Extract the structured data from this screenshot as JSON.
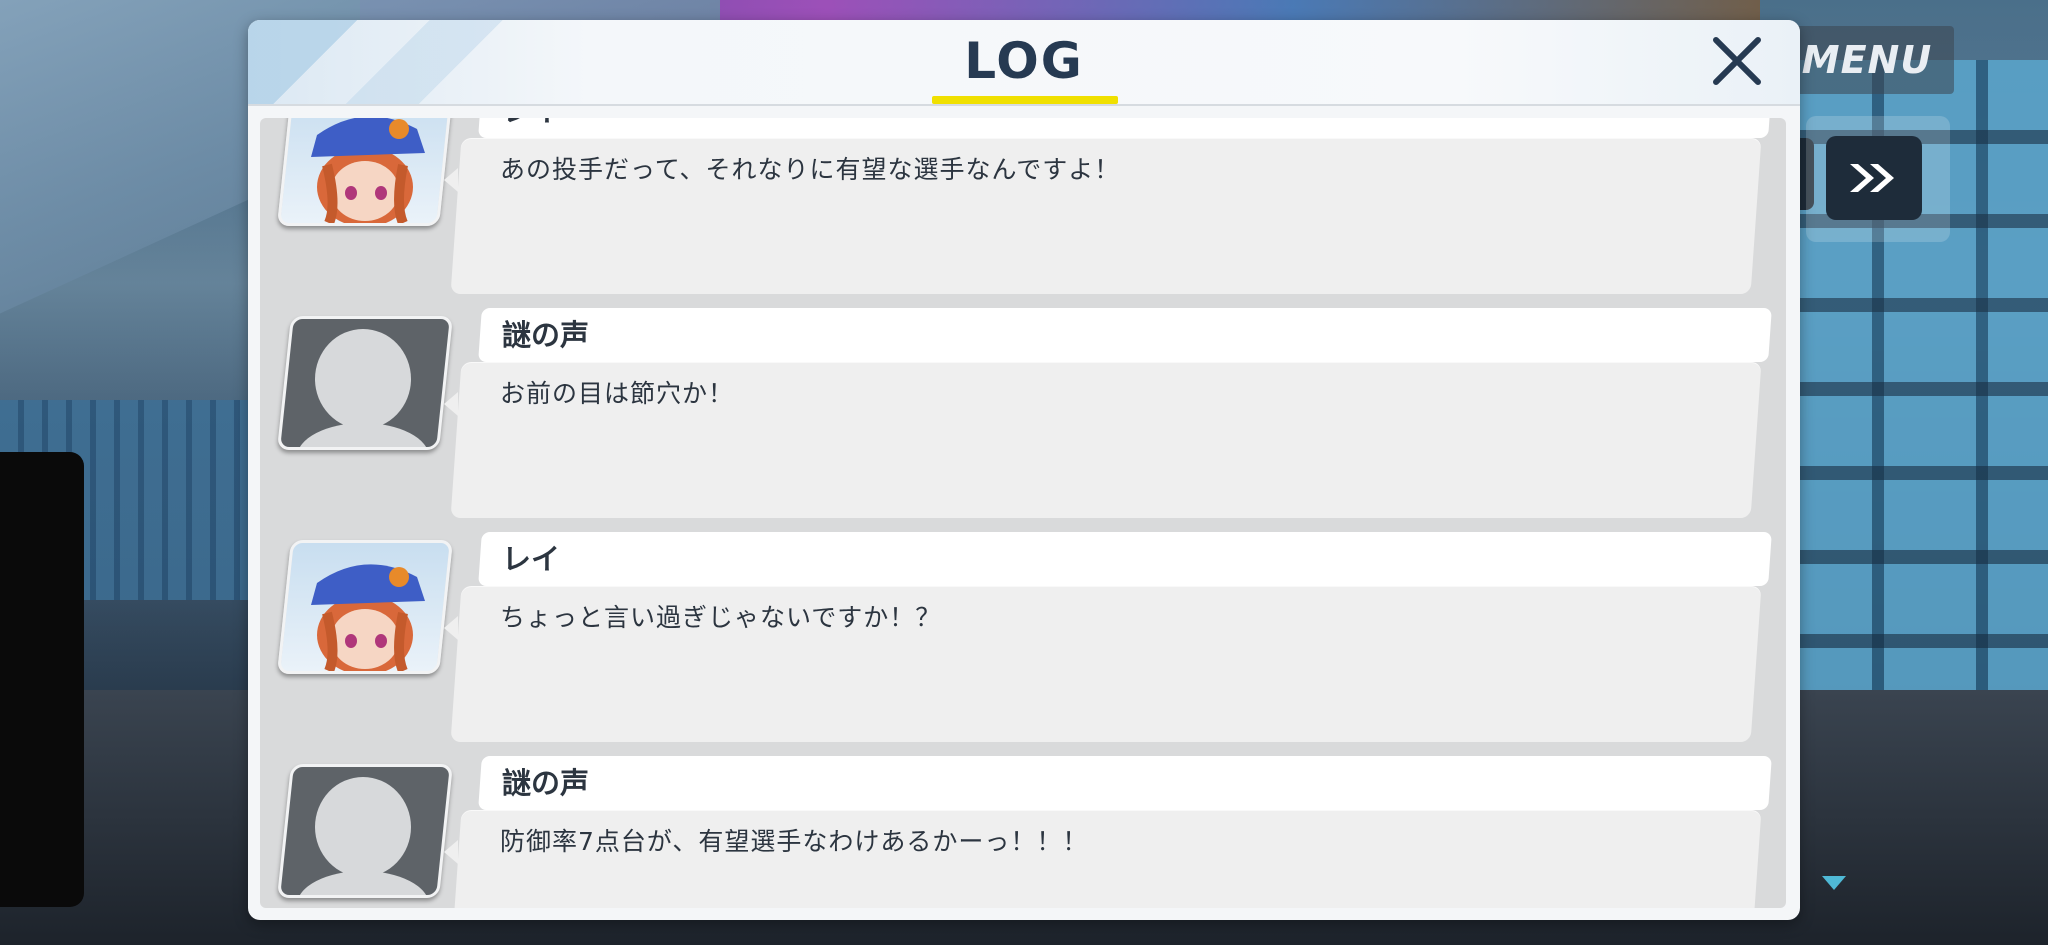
{
  "header": {
    "title": "LOG",
    "accent_color": "#f0e000",
    "close_icon": "close-icon"
  },
  "overlay": {
    "menu_label": "MENU",
    "skip_icon": "fast-forward-icon"
  },
  "log_entries": [
    {
      "speaker": "レイ",
      "avatar": "rei-portrait",
      "message": "あの投手だって、それなりに有望な選手なんですよ！"
    },
    {
      "speaker": "謎の声",
      "avatar": "unknown-silhouette",
      "message": "お前の目は節穴か！"
    },
    {
      "speaker": "レイ",
      "avatar": "rei-portrait",
      "message": "ちょっと言い過ぎじゃないですか！？"
    },
    {
      "speaker": "謎の声",
      "avatar": "unknown-silhouette",
      "message": "防御率7点台が、有望選手なわけあるかーっ！！！"
    }
  ],
  "colors": {
    "title_text": "#263a52",
    "name_bar": "#ffffff",
    "bubble": "#efefef",
    "log_background": "#d9dadb"
  }
}
